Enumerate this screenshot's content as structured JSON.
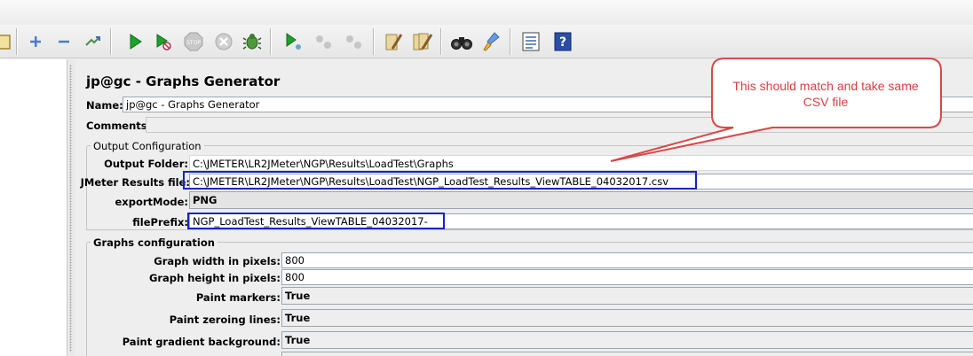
{
  "toolbar": {
    "icons": [
      "template-icon",
      "expand-icon",
      "collapse-icon",
      "toggle-icon",
      "start-icon",
      "start-no-pauses-icon",
      "stop-icon",
      "shutdown-icon",
      "debug-bug-icon",
      "remote-start-icon",
      "remote-stop-icon",
      "remote-exit-icon",
      "clear-icon",
      "clear-all-icon",
      "search-icon",
      "reset-search-icon",
      "function-helper-icon",
      "help-icon"
    ],
    "stop_label": "STOP"
  },
  "panel": {
    "title": "jp@gc - Graphs Generator",
    "name_label": "Name:",
    "name_value": "jp@gc - Graphs Generator",
    "comments_label": "Comments:"
  },
  "output_config": {
    "legend": "Output Configuration",
    "output_folder_label": "Output Folder:",
    "output_folder_value": "C:\\JMETER\\LR2JMeter\\NGP\\Results\\LoadTest\\Graphs",
    "results_file_label": "JMeter Results file:",
    "results_file_value": "C:\\JMETER\\LR2JMeter\\NGP\\Results\\LoadTest\\NGP_LoadTest_Results_ViewTABLE_04032017.csv",
    "export_mode_label": "exportMode:",
    "export_mode_value": "PNG",
    "file_prefix_label": "filePrefix:",
    "file_prefix_value": "NGP_LoadTest_Results_ViewTABLE_04032017-"
  },
  "graphs_config": {
    "legend": "Graphs configuration",
    "width_label": "Graph width in pixels:",
    "width_value": "800",
    "height_label": "Graph height in pixels:",
    "height_value": "800",
    "markers_label": "Paint markers:",
    "markers_value": "True",
    "zeroing_label": "Paint zeroing lines:",
    "zeroing_value": "True",
    "gradient_label": "Paint gradient background:",
    "gradient_value": "True"
  },
  "callout": {
    "text": "This should match and take same CSV file",
    "color": "#d94040"
  },
  "colors": {
    "highlight_box": "#1424c8",
    "panel_bg": "#eeeeee"
  }
}
